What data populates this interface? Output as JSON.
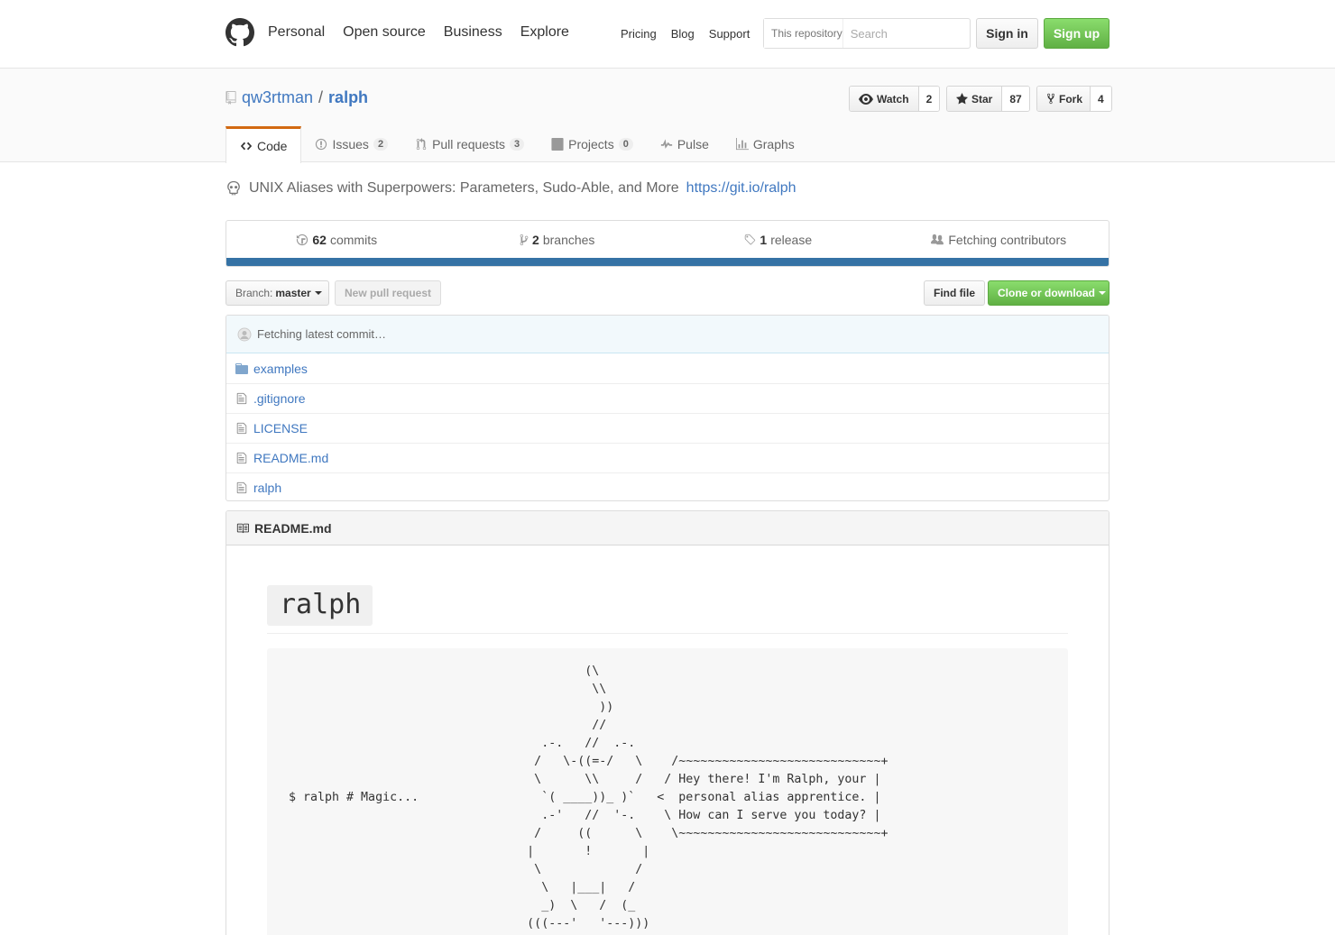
{
  "header": {
    "nav": [
      "Personal",
      "Open source",
      "Business",
      "Explore"
    ],
    "subnav": [
      "Pricing",
      "Blog",
      "Support"
    ],
    "search_scope": "This repository",
    "search_placeholder": "Search",
    "signin": "Sign in",
    "signup": "Sign up"
  },
  "repo": {
    "owner": "qw3rtman",
    "separator": "/",
    "name": "ralph",
    "watch": {
      "label": "Watch",
      "count": "2"
    },
    "star": {
      "label": "Star",
      "count": "87"
    },
    "fork": {
      "label": "Fork",
      "count": "4"
    }
  },
  "tabs": [
    {
      "label": "Code",
      "counter": null,
      "icon": "code-icon"
    },
    {
      "label": "Issues",
      "counter": "2",
      "icon": "issue-icon"
    },
    {
      "label": "Pull requests",
      "counter": "3",
      "icon": "pull-request-icon"
    },
    {
      "label": "Projects",
      "counter": "0",
      "icon": "project-icon"
    },
    {
      "label": "Pulse",
      "counter": null,
      "icon": "pulse-icon"
    },
    {
      "label": "Graphs",
      "counter": null,
      "icon": "graph-icon"
    }
  ],
  "description": {
    "text": "UNIX Aliases with Superpowers: Parameters, Sudo-Able, and More",
    "link": "https://git.io/ralph"
  },
  "summary": {
    "commits_num": "62",
    "commits_label": "commits",
    "branches_num": "2",
    "branches_label": "branches",
    "releases_num": "1",
    "releases_label": "release",
    "contributors": "Fetching contributors",
    "language_color": "#3572a5"
  },
  "branch": {
    "prefix": "Branch:",
    "name": "master",
    "new_pr": "New pull request",
    "find_file": "Find file",
    "clone": "Clone or download"
  },
  "commit_tease": "Fetching latest commit…",
  "files": [
    {
      "name": "examples",
      "type": "dir"
    },
    {
      "name": ".gitignore",
      "type": "file"
    },
    {
      "name": "LICENSE",
      "type": "file"
    },
    {
      "name": "README.md",
      "type": "file"
    },
    {
      "name": "ralph",
      "type": "file"
    }
  ],
  "readme": {
    "filename": "README.md",
    "title": "ralph",
    "ascii": "                                         (\\\n                                          \\\\\n                                           ))\n                                          //\n                                   .-.   //  .-.\n                                  /   \\-((=-/   \\    /~~~~~~~~~~~~~~~~~~~~~~~~~~~~+\n                                  \\      \\\\     /   / Hey there! I'm Ralph, your |\n$ ralph # Magic...                 `( ____))_ )`   <  personal alias apprentice. |\n                                   .-'   //  '-.    \\ How can I serve you today? |\n                                  /     ((      \\    \\~~~~~~~~~~~~~~~~~~~~~~~~~~~~+\n                                 |       !       |\n                                  \\             /\n                                   \\   |___|   /\n                                   _)  \\   /  (_\n                                 (((---'   '---)))"
  }
}
